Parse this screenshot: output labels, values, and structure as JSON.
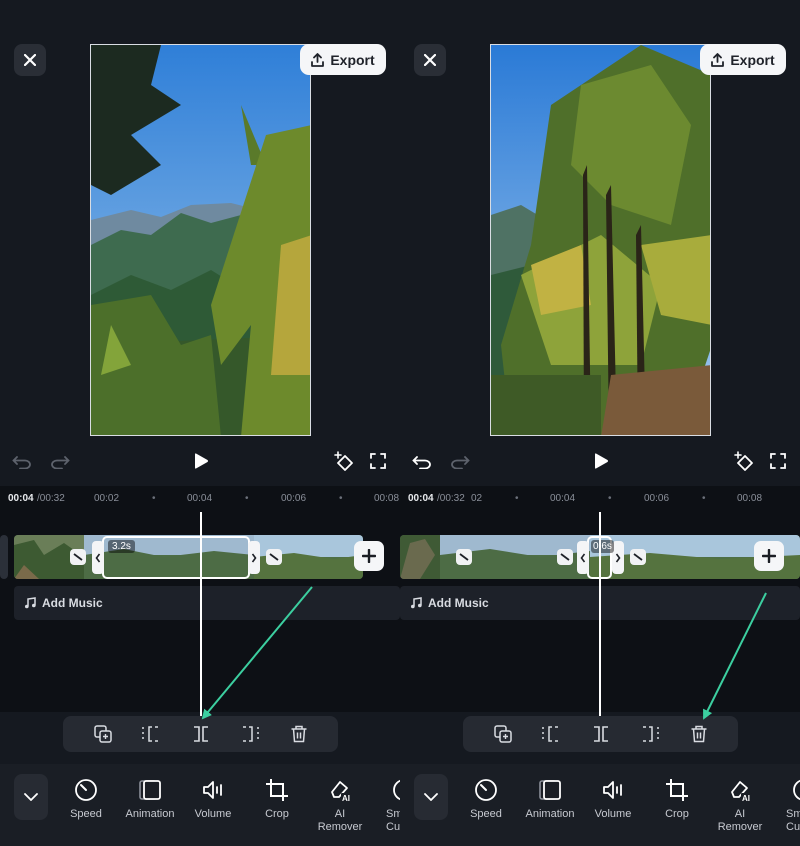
{
  "app": {
    "accent_arrow": "#3ccfa0",
    "export_label": "Export"
  },
  "left": {
    "ruler": {
      "current": "00:04",
      "total": "/00:32",
      "ticks": [
        "00:02",
        "00:04",
        "00:06",
        "00:08"
      ]
    },
    "selected_duration": "3.2s",
    "music_label": "Add Music",
    "bottom": [
      "Speed",
      "Animation",
      "Volume",
      "Crop",
      "AI\nRemover",
      "Sm\nCu"
    ]
  },
  "right": {
    "ruler": {
      "current": "00:04",
      "total": "/00:32",
      "ticks": [
        "02",
        "00:04",
        "00:06",
        "00:08"
      ]
    },
    "selected_duration": "0.6s",
    "music_label": "Add Music",
    "bottom": [
      "Speed",
      "Animation",
      "Volume",
      "Crop",
      "AI\nRemover",
      "Sm\nCu"
    ]
  },
  "icons": {
    "close": "close-icon",
    "export": "upload-icon",
    "undo": "undo-icon",
    "redo": "redo-icon",
    "play": "play-icon",
    "keyframe": "keyframe-add-icon",
    "fullscreen": "fullscreen-icon",
    "toolbar": [
      "duplicate-icon",
      "split-left-icon",
      "split-icon",
      "split-right-icon",
      "trash-icon"
    ]
  }
}
